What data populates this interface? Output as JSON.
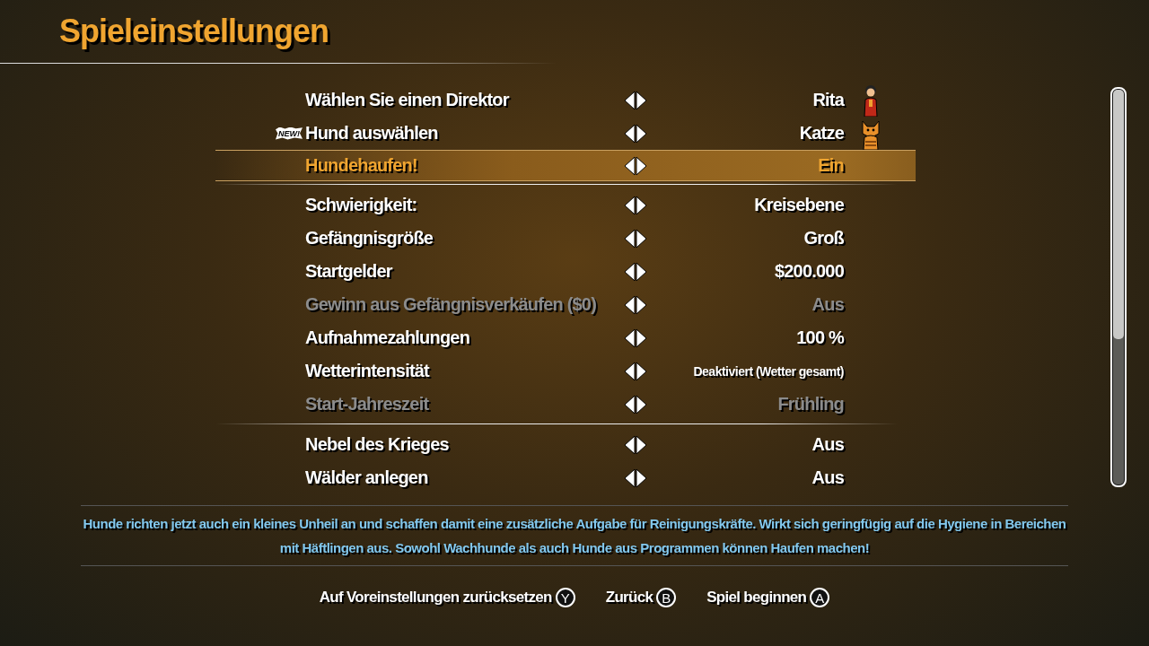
{
  "title": "Spieleinstellungen",
  "groups": [
    {
      "rows": [
        {
          "label": "Wählen Sie einen Direktor",
          "value": "Rita",
          "kind": "portrait",
          "selected": false,
          "disabled": false
        },
        {
          "label": "Hund auswählen",
          "value": "Katze",
          "kind": "pet",
          "badge": "NEW!",
          "selected": false,
          "disabled": false
        },
        {
          "label": "Hundehaufen!",
          "value": "Ein",
          "kind": "plain",
          "selected": true,
          "disabled": false
        }
      ]
    },
    {
      "rows": [
        {
          "label": "Schwierigkeit:",
          "value": "Kreisebene",
          "kind": "plain",
          "selected": false,
          "disabled": false
        },
        {
          "label": "Gefängnisgröße",
          "value": "Groß",
          "kind": "plain",
          "selected": false,
          "disabled": false
        },
        {
          "label": "Startgelder",
          "value": "$200.000",
          "kind": "plain",
          "selected": false,
          "disabled": false
        },
        {
          "label": "Gewinn aus Gefängnisverkäufen ($0)",
          "value": "Aus",
          "kind": "plain",
          "selected": false,
          "disabled": true
        },
        {
          "label": "Aufnahmezahlungen",
          "value": "100 %",
          "kind": "plain",
          "selected": false,
          "disabled": false
        },
        {
          "label": "Wetterintensität",
          "value": "Deaktiviert (Wetter gesamt)",
          "kind": "plain",
          "selected": false,
          "disabled": false
        },
        {
          "label": "Start-Jahreszeit",
          "value": "Frühling",
          "kind": "plain",
          "selected": false,
          "disabled": true
        }
      ]
    },
    {
      "rows": [
        {
          "label": "Nebel des Krieges",
          "value": "Aus",
          "kind": "plain",
          "selected": false,
          "disabled": false
        },
        {
          "label": "Wälder anlegen",
          "value": "Aus",
          "kind": "plain",
          "selected": false,
          "disabled": false
        }
      ]
    }
  ],
  "description": "Hunde richten jetzt auch ein kleines Unheil an und schaffen damit eine zusätzliche Aufgabe für Reinigungskräfte. Wirkt sich geringfügig auf die Hygiene in Bereichen mit Häftlingen aus. Sowohl Wachhunde als auch Hunde aus Programmen können Haufen machen!",
  "buttons": [
    {
      "label": "Auf Voreinstellungen zurücksetzen",
      "key": "Y"
    },
    {
      "label": "Zurück",
      "key": "B"
    },
    {
      "label": "Spiel beginnen",
      "key": "A"
    }
  ]
}
